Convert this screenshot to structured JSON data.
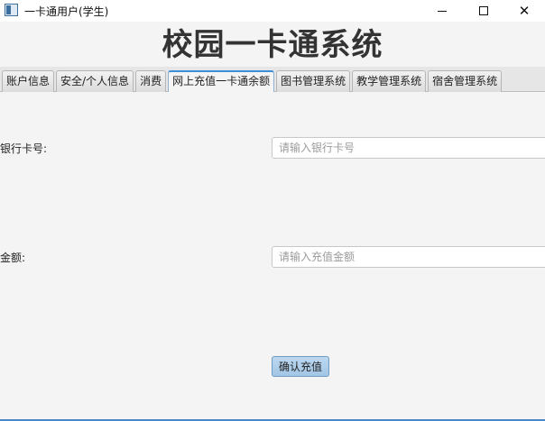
{
  "window": {
    "title": "一卡通用户(学生)"
  },
  "header": {
    "title": "校园一卡通系统"
  },
  "tabs": [
    {
      "label": "账户信息",
      "active": false
    },
    {
      "label": "安全/个人信息",
      "active": false
    },
    {
      "label": "消费",
      "active": false
    },
    {
      "label": "网上充值一卡通余额",
      "active": true
    },
    {
      "label": "图书管理系统",
      "active": false
    },
    {
      "label": "教学管理系统",
      "active": false
    },
    {
      "label": "宿舍管理系统",
      "active": false
    }
  ],
  "form": {
    "card_label": "银行卡号:",
    "card_placeholder": "请输入银行卡号",
    "card_value": "",
    "amount_label": "金额:",
    "amount_placeholder": "请输入充值金额",
    "amount_value": "",
    "confirm_label": "确认充值"
  },
  "colors": {
    "active_tab_accent": "#3a8fd6",
    "button_fill": "#a2c6e6",
    "bottom_border": "#4d86c4"
  }
}
